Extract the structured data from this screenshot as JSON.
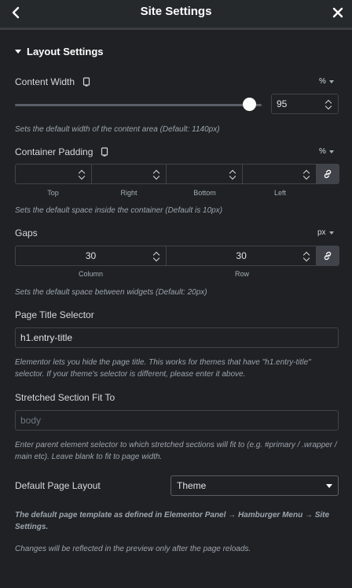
{
  "header": {
    "title": "Site Settings"
  },
  "section": {
    "title": "Layout Settings"
  },
  "content_width": {
    "label": "Content Width",
    "unit": "%",
    "value": "95",
    "slider_fraction": 0.95,
    "description": "Sets the default width of the content area (Default: 1140px)"
  },
  "container_padding": {
    "label": "Container Padding",
    "unit": "%",
    "fields": [
      {
        "label": "Top",
        "value": ""
      },
      {
        "label": "Right",
        "value": ""
      },
      {
        "label": "Bottom",
        "value": ""
      },
      {
        "label": "Left",
        "value": ""
      }
    ],
    "description": "Sets the default space inside the container (Default is 10px)"
  },
  "gaps": {
    "label": "Gaps",
    "unit": "px",
    "fields": [
      {
        "label": "Column",
        "value": "30"
      },
      {
        "label": "Row",
        "value": "30"
      }
    ],
    "description": "Sets the default space between widgets (Default: 20px)"
  },
  "page_title_selector": {
    "label": "Page Title Selector",
    "value": "h1.entry-title",
    "description": "Elementor lets you hide the page title. This works for themes that have \"h1.entry-title\" selector. If your theme's selector is different, please enter it above."
  },
  "stretched_section": {
    "label": "Stretched Section Fit To",
    "placeholder": "body",
    "description": "Enter parent element selector to which stretched sections will fit to (e.g. #primary / .wrapper / main etc). Leave blank to fit to page width."
  },
  "default_page_layout": {
    "label": "Default Page Layout",
    "selected": "Theme"
  },
  "notes": {
    "template_note": "The default page template as defined in Elementor Panel → Hamburger Menu → Site Settings.",
    "reload_note": "Changes will be reflected in the preview only after the page reloads."
  }
}
